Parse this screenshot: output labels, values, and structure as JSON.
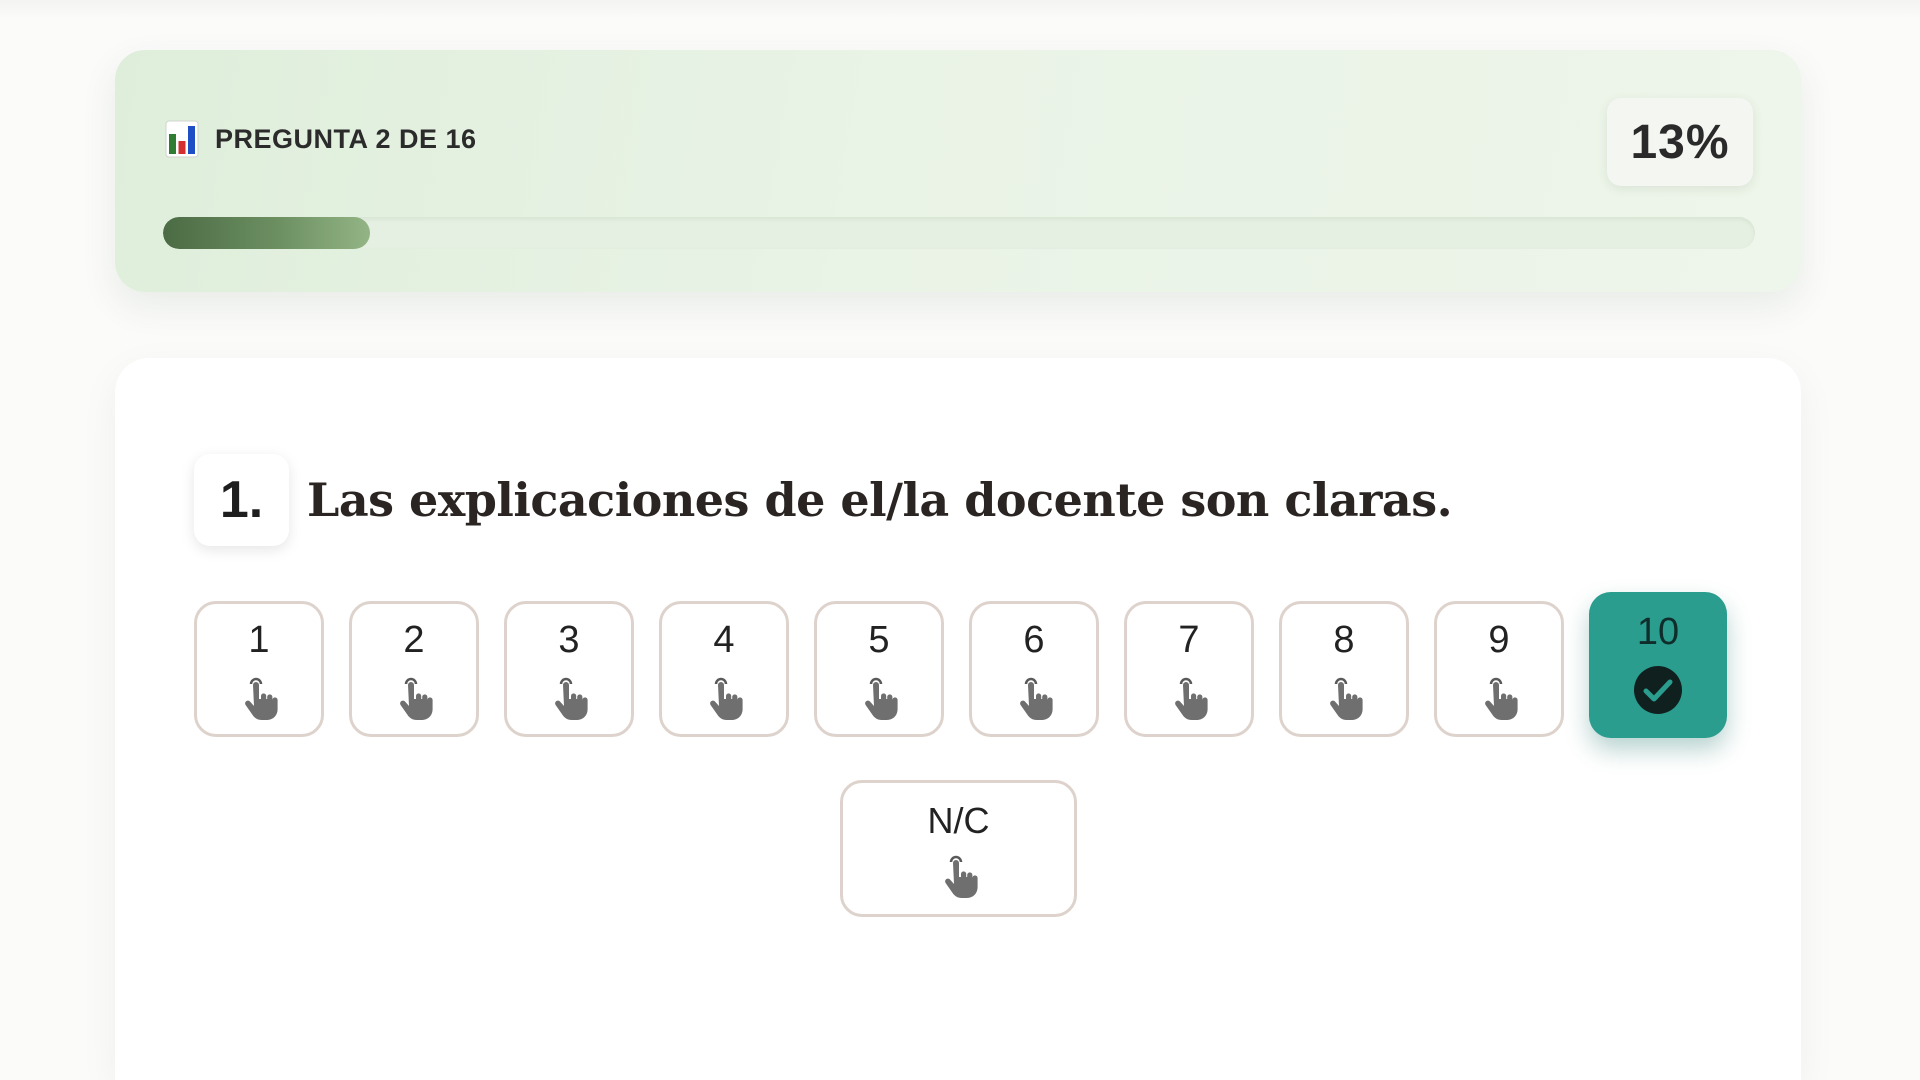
{
  "progress": {
    "label": "PREGUNTA 2 DE 16",
    "percent_text": "13%",
    "fraction": 0.13,
    "icon": "bar-chart-icon"
  },
  "question": {
    "number": "1.",
    "text": "Las explicaciones de el/la docente son claras."
  },
  "options": [
    "1",
    "2",
    "3",
    "4",
    "5",
    "6",
    "7",
    "8",
    "9",
    "10"
  ],
  "selected_option": "10",
  "na_option": "N/C",
  "icons": {
    "option": "pointer-hand-icon",
    "selected": "check-circle-icon"
  },
  "colors": {
    "accent_selected": "#2a9d8f",
    "progress_fill": "#4b6b44",
    "progress_card": "#e3f0df",
    "option_border": "#ddd3cc"
  }
}
